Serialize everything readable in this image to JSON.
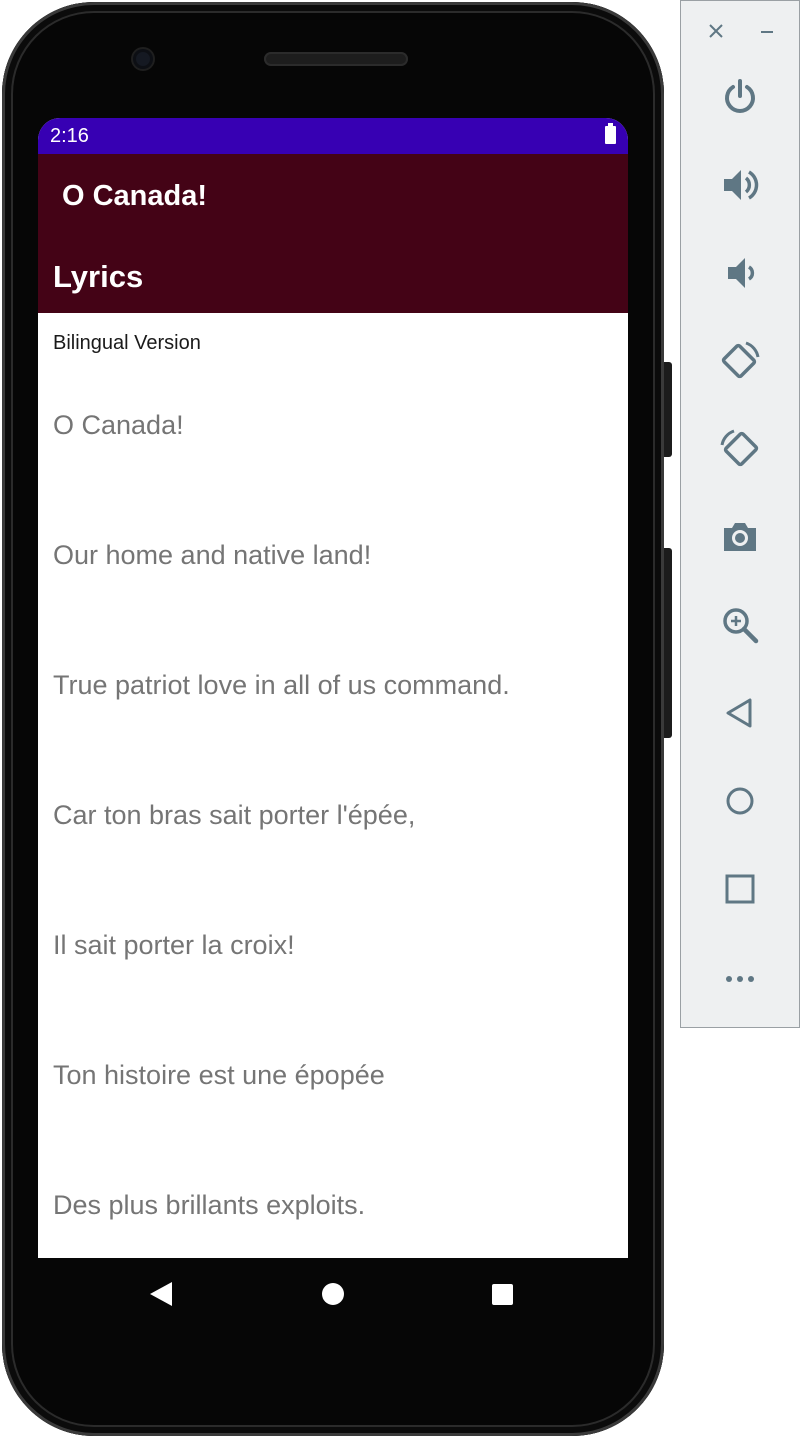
{
  "status_bar": {
    "time": "2:16",
    "color": "#3700b3"
  },
  "app_bar": {
    "title": "O Canada!",
    "section_title": "Lyrics",
    "color": "#440316"
  },
  "content": {
    "subtitle": "Bilingual Version",
    "lines": [
      "O Canada!",
      " Our home and native land!",
      " True patriot love in all of us command.",
      " Car ton bras sait porter l'épée,",
      " Il sait porter la croix!",
      " Ton histoire est une épopée",
      " Des plus brillants exploits."
    ]
  },
  "nav_bar": {
    "back_icon": "triangle-back",
    "home_icon": "circle-home",
    "recents_icon": "square-recents"
  },
  "emulator_panel": {
    "close_icon": "close-icon",
    "minimize_icon": "minimize-icon",
    "controls": [
      "power-icon",
      "volume-up-icon",
      "volume-down-icon",
      "rotate-left-icon",
      "rotate-right-icon",
      "camera-icon",
      "zoom-icon",
      "back-icon",
      "home-icon",
      "overview-icon",
      "more-icon"
    ],
    "icon_color": "#5f7784"
  }
}
